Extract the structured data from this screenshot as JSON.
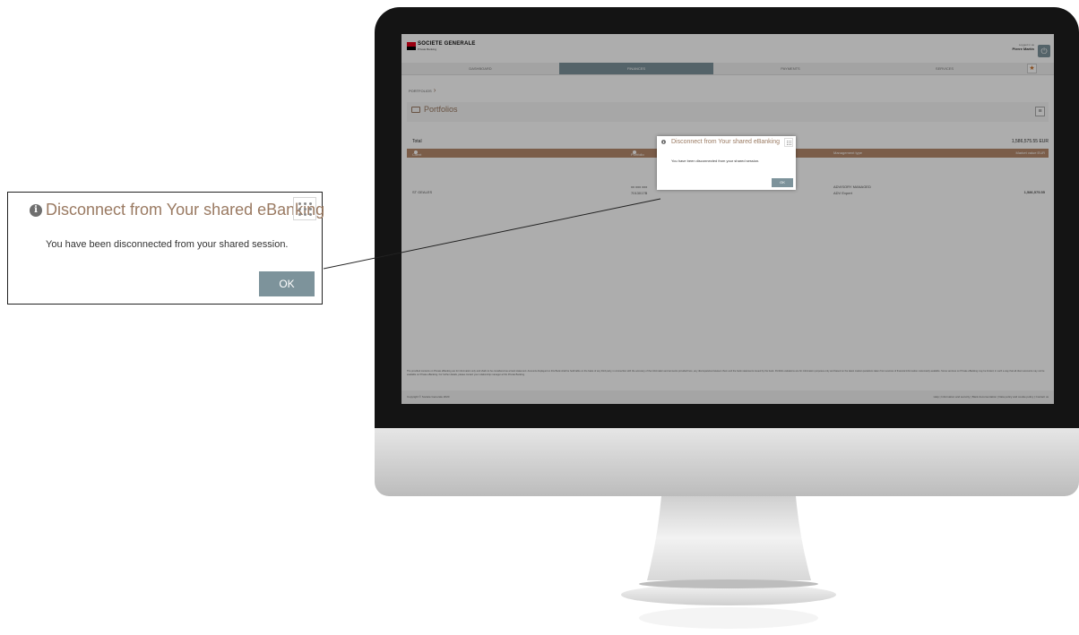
{
  "dialog": {
    "title": "Disconnect from Your shared eBanking",
    "message": "You have been disconnected from your shared session.",
    "ok_label": "OK",
    "icon": "info-icon",
    "drag_icon": "grip-dots-icon"
  },
  "brand": {
    "name": "SOCIETE GENERALE",
    "subtitle": "Private Banking"
  },
  "user": {
    "logged_label": "Logged in as",
    "name": "Pierre Martin"
  },
  "nav": {
    "tabs": [
      "DASHBOARD",
      "FINANCES",
      "PAYMENTS",
      "SERVICES"
    ],
    "active": "FINANCES"
  },
  "breadcrumb": "PORTFOLIOS",
  "section_title": "Portfolios",
  "table": {
    "total_label": "Total",
    "total_value": "1,586,575.55 EUR",
    "headers": {
      "client": "Client",
      "portfolio": "Portfolio",
      "management": "Management type",
      "market": "Market value EUR"
    },
    "row": {
      "client": "ST GEALES",
      "portfolio_1": "xx xxx xxx",
      "portfolio_2": "7013017B",
      "management_1": "ADVISORY MANAGED",
      "management_2": "ADV Expert",
      "value": "1,586,575.55"
    }
  },
  "footer": {
    "copyright": "Copyright © Societe Generale 2020",
    "links": "Help | Information and security | Bank documentation | Data policy and cookie policy | Contact us",
    "disclaimer": "The provided contents on Private eBanking are for information only and shall not be considered as a bank statement. Amounts displayed on this Bank shall be held liable on the basis of any third party, in connection with the accuracy of the information and amounts provided here, any discrepancies between them and the bank statements issued by the bank. Portfolio valuations are for information purposes only and based on the latest market quotations taken from sources of financial information customarily available. Some services on Private eBanking may be limited, in such a way that all client accounts may not be available on Private eBanking. For further details, please contact your relationship manager at SG Private Banking."
  },
  "colors": {
    "accent": "#9a7a62",
    "table_header": "#b58a6c",
    "button": "#7d939b",
    "brand_red": "#e2001a"
  }
}
